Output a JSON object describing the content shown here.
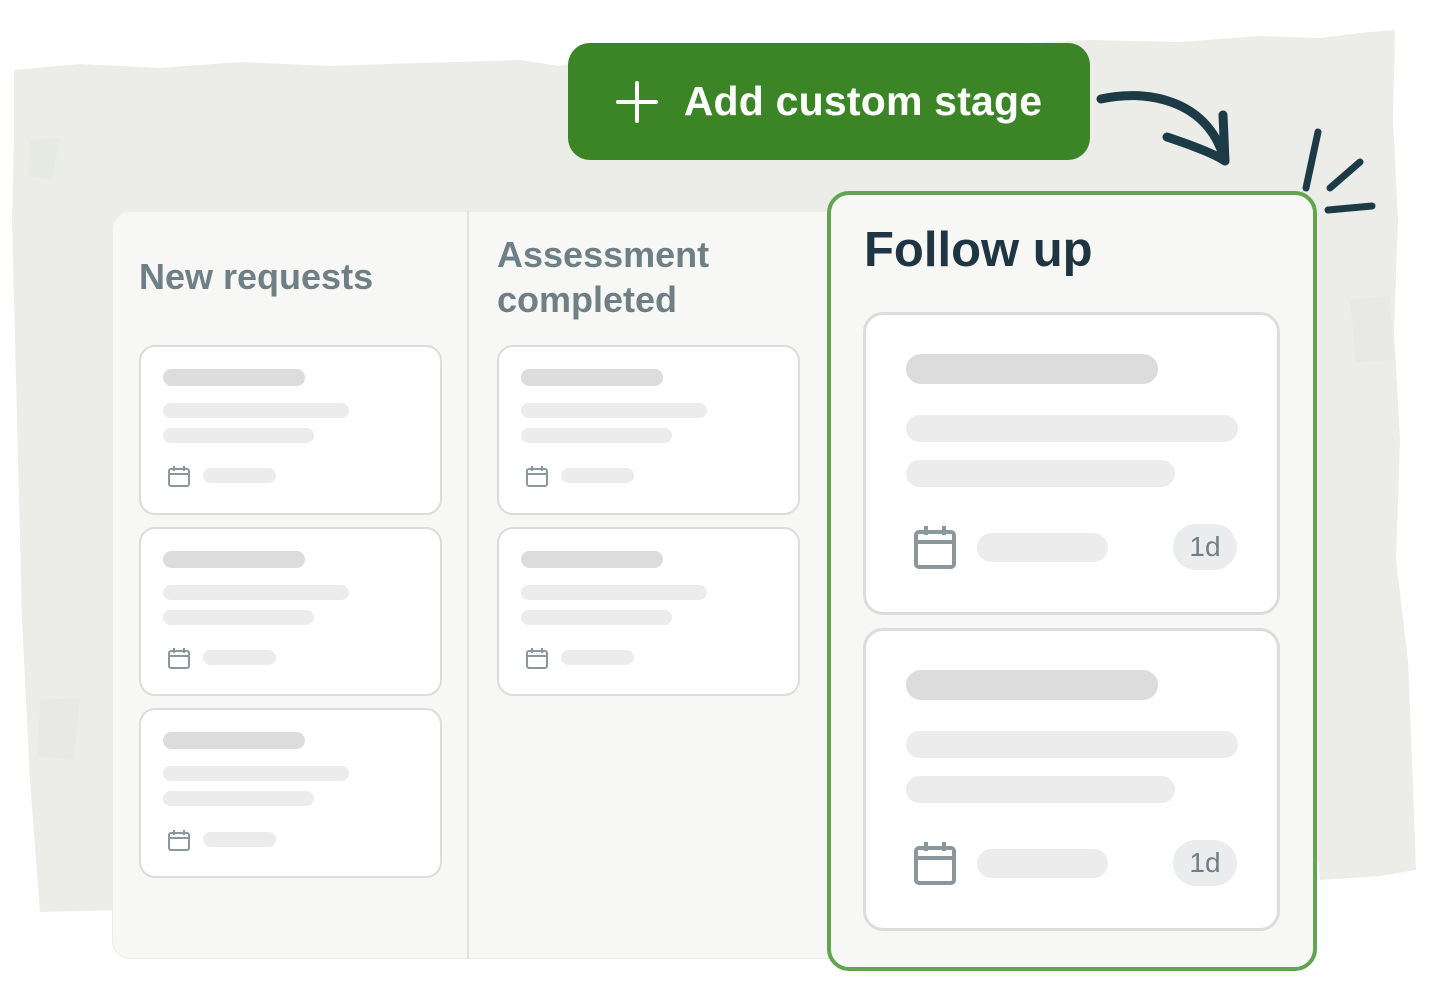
{
  "add_stage_button": {
    "label": "Add custom stage",
    "icon": "plus-icon"
  },
  "columns": [
    {
      "title": "New requests"
    },
    {
      "title": "Assessment completed",
      "title_lines": [
        "Assessment",
        "completed"
      ]
    }
  ],
  "highlighted_column": {
    "title": "Follow up",
    "cards": [
      {
        "age": "1d"
      },
      {
        "age": "1d"
      }
    ]
  },
  "colors": {
    "accent_green": "#3b8526",
    "highlight_border": "#62a550",
    "paper": "#ecede8",
    "heading_muted": "#6f7f86",
    "heading_dark": "#1f3541",
    "doodle": "#1d3a47"
  },
  "icons": [
    "plus-icon",
    "calendar-icon",
    "curved-arrow-icon",
    "sparkle-lines-icon"
  ]
}
